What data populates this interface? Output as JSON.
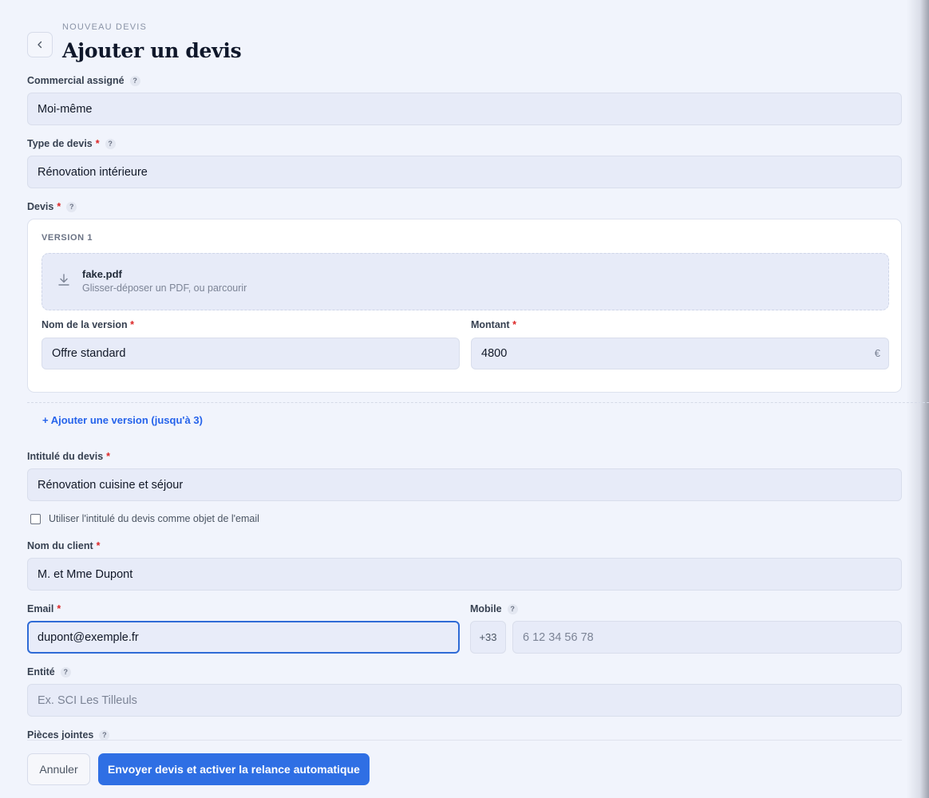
{
  "header": {
    "eyebrow": "NOUVEAU DEVIS",
    "title": "Ajouter un devis",
    "back_icon": "chevron-left-icon"
  },
  "commercial": {
    "label": "Commercial assigné",
    "help": "?",
    "value": "Moi-même"
  },
  "type_devis": {
    "label": "Type de devis",
    "required": "*",
    "help": "?",
    "value": "Rénovation intérieure"
  },
  "devis": {
    "label": "Devis",
    "required": "*",
    "help": "?",
    "version_label": "VERSION 1",
    "file_name": "fake.pdf",
    "dropzone_hint": "Glisser-déposer un PDF, ou parcourir",
    "upload_icon": "download-icon",
    "version_name_label": "Nom de la version",
    "version_name_value": "Offre standard",
    "amount_label": "Montant",
    "amount_value": "4800",
    "currency": "€",
    "add_version": "+ Ajouter une version (jusqu'à 3)"
  },
  "intitule": {
    "label": "Intitulé du devis",
    "required": "*",
    "value": "Rénovation cuisine et séjour",
    "checkbox_label": "Utiliser l'intitulé du devis comme objet de l'email",
    "checkbox_checked": false
  },
  "client": {
    "label": "Nom du client",
    "required": "*",
    "value": "M. et Mme Dupont"
  },
  "email": {
    "label": "Email",
    "required": "*",
    "value": "dupont@exemple.fr"
  },
  "mobile": {
    "label": "Mobile",
    "help": "?",
    "prefix": "+33",
    "placeholder": "6 12 34 56 78"
  },
  "entite": {
    "label": "Entité",
    "help": "?",
    "placeholder": "Ex. SCI Les Tilleuls"
  },
  "pieces_jointes": {
    "label": "Pièces jointes",
    "help": "?"
  },
  "footer": {
    "cancel": "Annuler",
    "send": "Envoyer devis et activer la relance automatique"
  },
  "colors": {
    "accent": "#2f6fe4",
    "required": "#dc2626",
    "field_bg": "#e7ebf8",
    "page_bg": "#f1f4fc"
  }
}
